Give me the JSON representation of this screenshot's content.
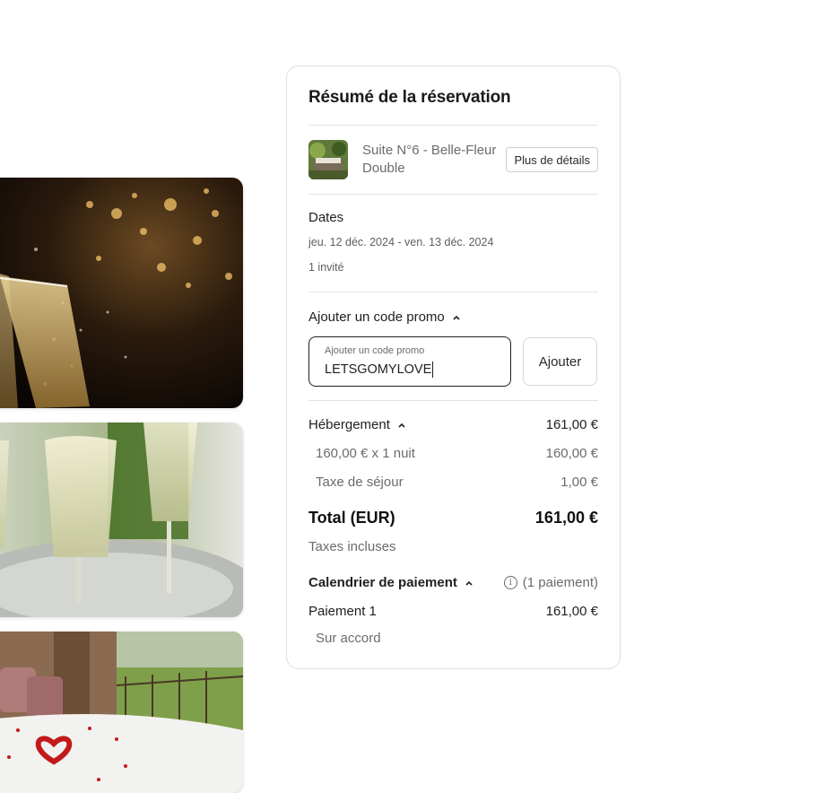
{
  "summary": {
    "title": "Résumé de la réservation",
    "room": {
      "name": "Suite N°6 - Belle-Fleur Double",
      "details_button": "Plus de détails"
    },
    "dates": {
      "label": "Dates",
      "range": "jeu. 12 déc. 2024 - ven. 13 déc. 2024",
      "guests": "1 invité"
    },
    "promo": {
      "toggle_label": "Ajouter un code promo",
      "field_label": "Ajouter un code promo",
      "value": "LETSGOMYLOVE",
      "add_button": "Ajouter"
    },
    "accommodation": {
      "label": "Hébergement",
      "amount": "161,00 €",
      "lines": [
        {
          "label": "160,00 € x 1 nuit",
          "amount": "160,00 €"
        },
        {
          "label": "Taxe de séjour",
          "amount": "1,00 €"
        }
      ]
    },
    "total": {
      "label": "Total (EUR)",
      "amount": "161,00 €",
      "note": "Taxes incluses"
    },
    "payment_schedule": {
      "label": "Calendrier de paiement",
      "count": "(1 paiement)",
      "payments": [
        {
          "label": "Paiement 1",
          "amount": "161,00 €",
          "note": "Sur accord"
        }
      ]
    }
  },
  "icons": {
    "chevron": "chevron-up-icon",
    "info": "info-icon"
  },
  "colors": {
    "text": "#1f1f1f",
    "muted": "#6b6b6b",
    "border": "#dedede"
  }
}
